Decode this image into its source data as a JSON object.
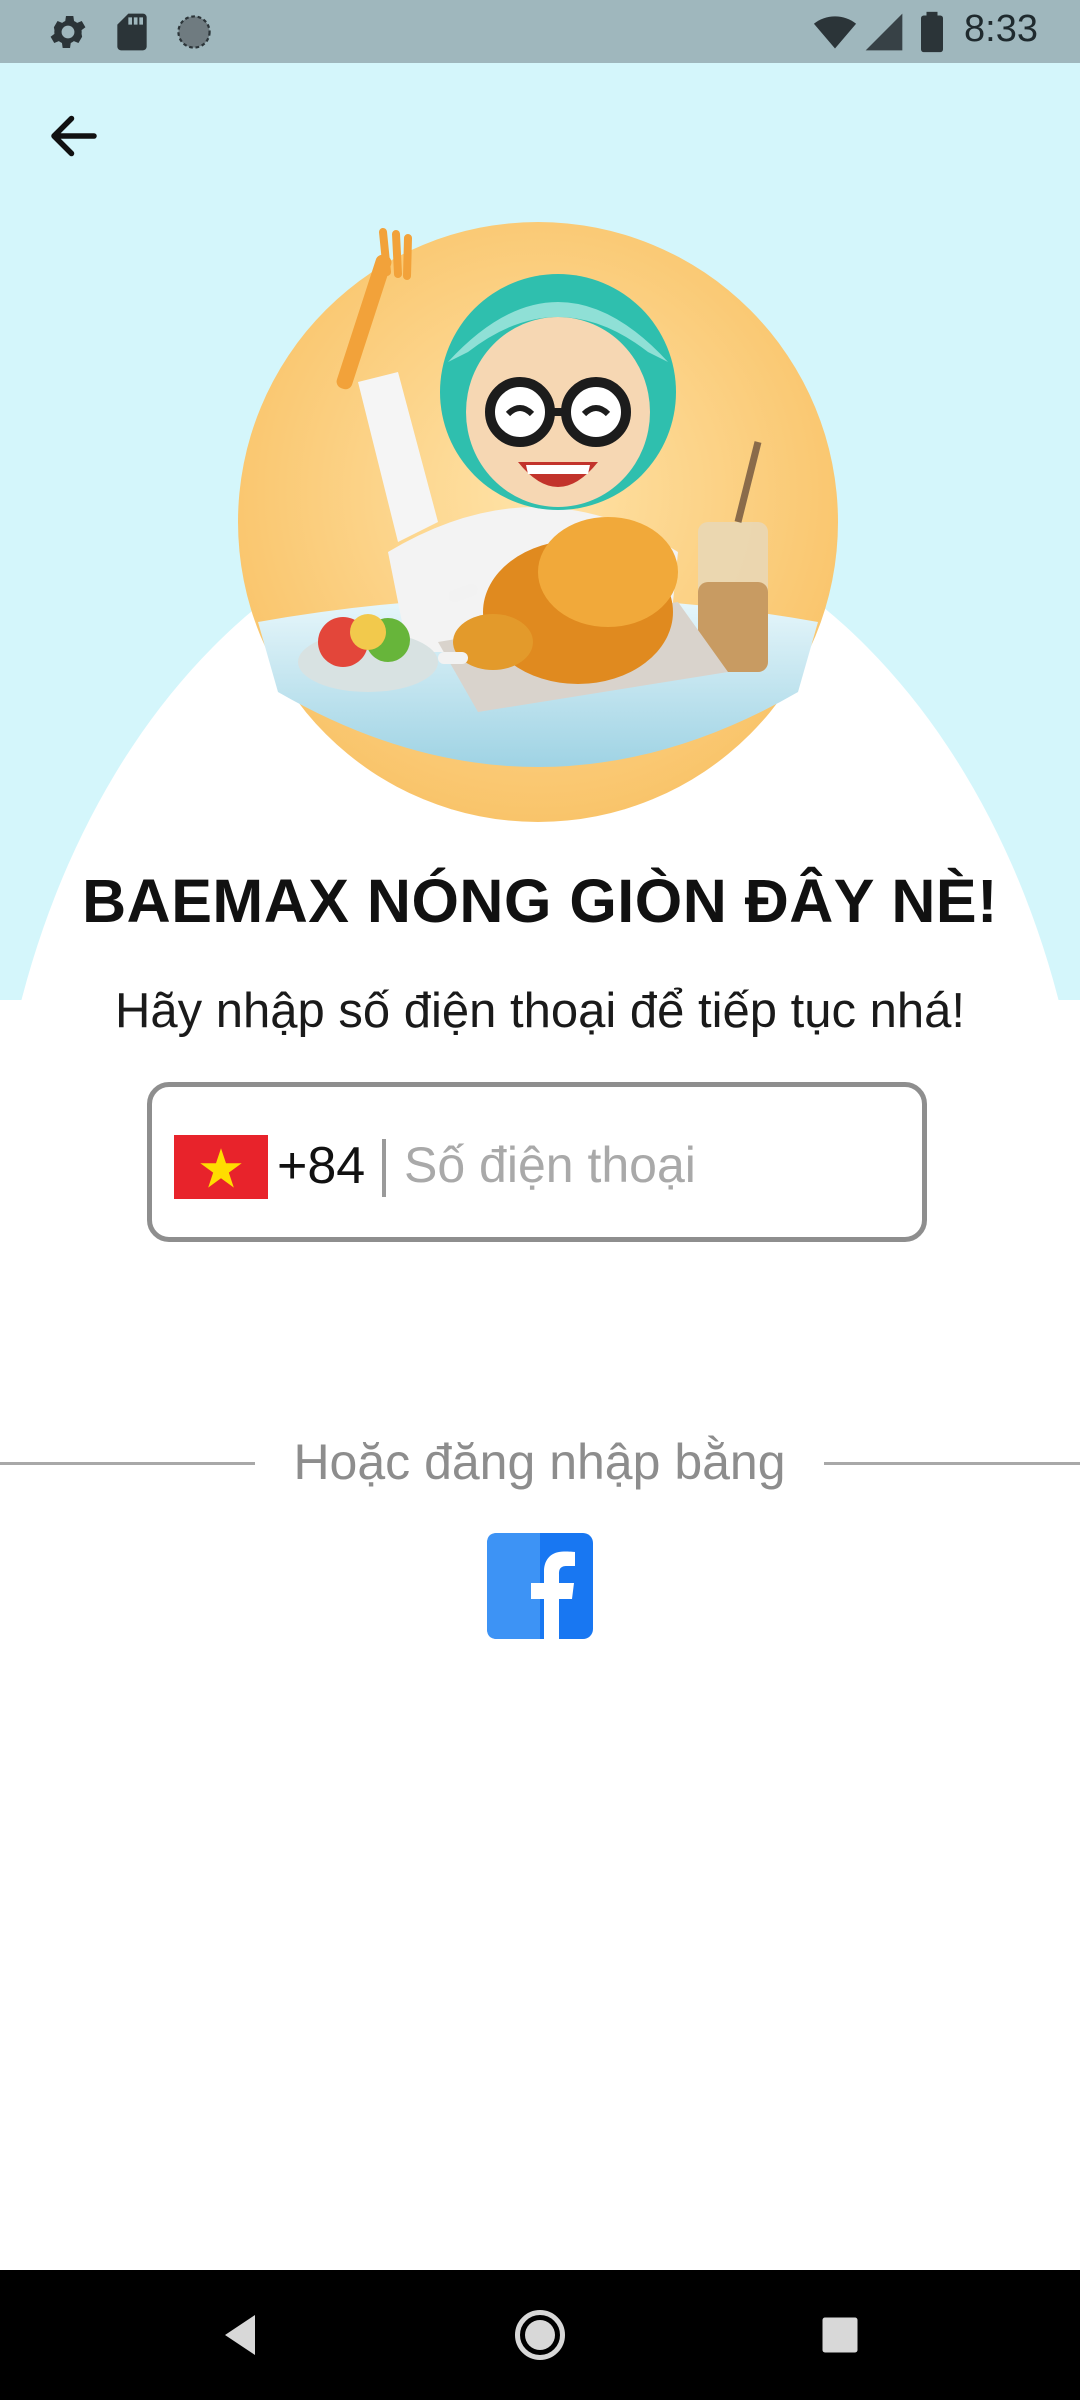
{
  "status_bar": {
    "time": "8:33",
    "left_icons": [
      "gear-icon",
      "sd-card-icon",
      "circle-icon"
    ],
    "right_icons": [
      "wifi-icon",
      "cell-signal-icon",
      "battery-icon"
    ]
  },
  "header": {
    "back_icon": "arrow-left-icon"
  },
  "hero": {
    "colors": {
      "sky": "#d4f6fb",
      "circle": "#fbd48a"
    }
  },
  "main": {
    "title": "BAEMAX NÓNG GIÒN ĐÂY NÈ!",
    "subtitle": "Hãy nhập số điện thoại để tiếp tục nhá!"
  },
  "phone_input": {
    "flag": "vietnam-flag-icon",
    "country_code": "+84",
    "placeholder": "Số điện thoại",
    "value": ""
  },
  "alt_login": {
    "label": "Hoặc đăng nhập bằng",
    "providers": [
      "facebook-icon"
    ],
    "facebook_color": "#1877f2"
  },
  "nav_bar": {
    "buttons": [
      "back-triangle-icon",
      "home-circle-icon",
      "recents-square-icon"
    ]
  }
}
